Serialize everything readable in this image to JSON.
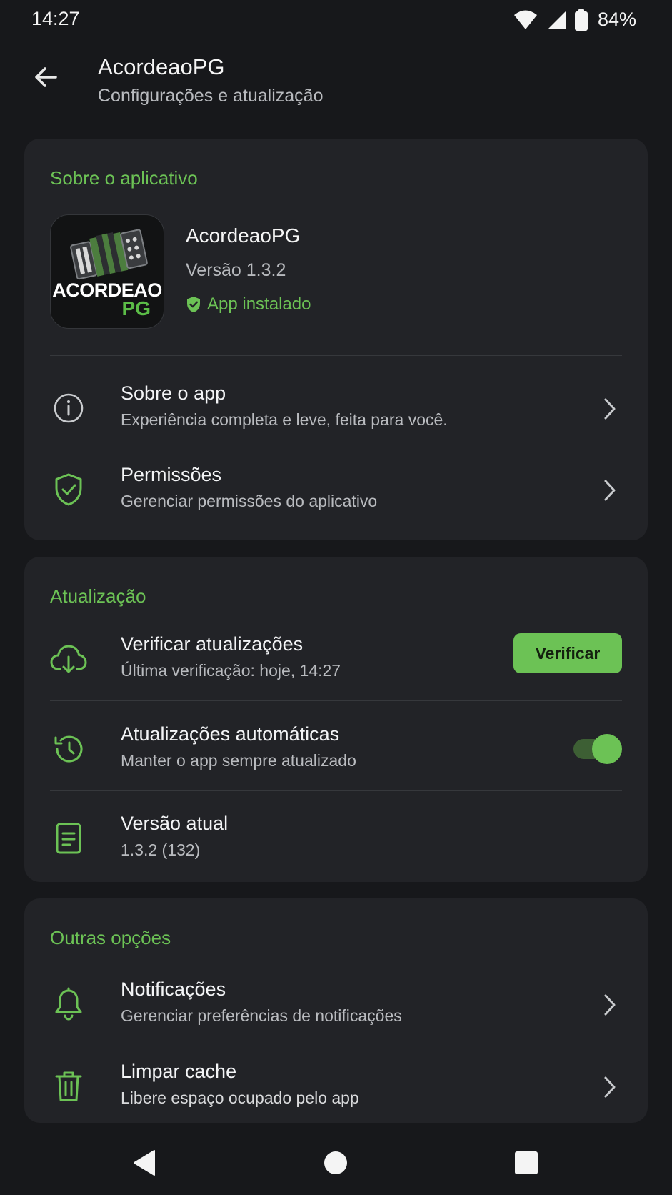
{
  "status_bar": {
    "time": "14:27",
    "battery": "84%"
  },
  "app_bar": {
    "title": "AcordeaoPG",
    "subtitle": "Configurações e atualização"
  },
  "about_section": {
    "title": "Sobre o aplicativo",
    "app_icon": {
      "word": "ACORDEAO",
      "suffix": "PG"
    },
    "app_name": "AcordeaoPG",
    "version": "Versão 1.3.2",
    "installed_status": "App instalado",
    "items": [
      {
        "icon": "info-icon",
        "title": "Sobre o app",
        "subtitle": "Experiência completa e leve, feita para você."
      },
      {
        "icon": "shield-check-icon",
        "title": "Permissões",
        "subtitle": "Gerenciar permissões do aplicativo"
      }
    ]
  },
  "update_section": {
    "title": "Atualização",
    "check": {
      "icon": "cloud-download-icon",
      "title": "Verificar atualizações",
      "subtitle": "Última verificação: hoje, 14:27",
      "button": "Verificar"
    },
    "auto": {
      "icon": "history-icon",
      "title": "Atualizações automáticas",
      "subtitle": "Manter o app sempre atualizado",
      "enabled": true
    },
    "current": {
      "icon": "document-icon",
      "title": "Versão atual",
      "value": "1.3.2 (132)"
    }
  },
  "other_section": {
    "title": "Outras opções",
    "items": [
      {
        "icon": "bell-icon",
        "title": "Notificações",
        "subtitle": "Gerenciar preferências de notificações"
      },
      {
        "icon": "trash-icon",
        "title": "Limpar cache",
        "subtitle": "Libere espaço ocupado pelo app"
      }
    ]
  },
  "colors": {
    "accent": "#6cc255",
    "background": "#17181b",
    "card": "#222327"
  }
}
